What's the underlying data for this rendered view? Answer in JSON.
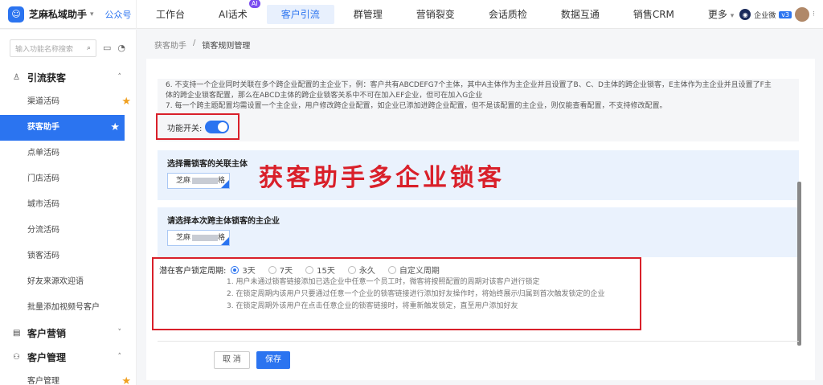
{
  "app": {
    "name": "芝麻私域助手",
    "tag": "公众号",
    "logo_glyph": "☺"
  },
  "nav": [
    {
      "label": "工作台",
      "badge": ""
    },
    {
      "label": "AI话术",
      "badge": "AI"
    },
    {
      "label": "客户引流",
      "badge": ""
    },
    {
      "label": "群管理",
      "badge": ""
    },
    {
      "label": "营销裂变",
      "badge": ""
    },
    {
      "label": "会话质检",
      "badge": ""
    },
    {
      "label": "数据互通",
      "badge": ""
    },
    {
      "label": "销售CRM",
      "badge": ""
    },
    {
      "label": "更多",
      "badge": ""
    }
  ],
  "topright": {
    "corp_label": "企业微",
    "version": "v3",
    "more": "⁝"
  },
  "sidebar": {
    "search_placeholder": "输入功能名称搜索",
    "groups": [
      {
        "label": "引流获客",
        "icon": "user-plus-icon",
        "expanded": true
      },
      {
        "label": "客户营销",
        "icon": "calendar-icon",
        "expanded": false
      },
      {
        "label": "客户管理",
        "icon": "user-manage-icon",
        "expanded": true
      }
    ],
    "items": [
      {
        "label": "渠道活码",
        "starred": true
      },
      {
        "label": "获客助手",
        "starred": true
      },
      {
        "label": "点单活码",
        "starred": false
      },
      {
        "label": "门店活码",
        "starred": false
      },
      {
        "label": "城市活码",
        "starred": false
      },
      {
        "label": "分流活码",
        "starred": false
      },
      {
        "label": "锁客活码",
        "starred": false
      },
      {
        "label": "好友来源欢迎语",
        "starred": false
      },
      {
        "label": "批量添加视频号客户",
        "starred": false
      },
      {
        "label": "客户管理",
        "starred": true
      }
    ]
  },
  "breadcrumb": {
    "parent": "获客助手",
    "sep": "/",
    "current": "锁客规则管理"
  },
  "notes": {
    "line6": "6. 不支持一个企业同时关联在多个跨企业配置的主企业下，例：客户共有ABCDEFG7个主体，其中A主体作为主企业并且设置了B、C、D主体的跨企业锁客，E主体作为主企业并且设置了F主",
    "line6b": "体的跨企业锁客配置，那么在ABCD主体的跨企业锁客关系中不可在加入EF企业，但可在加入G企业",
    "line7": "7. 每一个跨主题配置均需设置一个主企业，用户修改跨企业配置，如企业已添加进跨企业配置，但不是该配置的主企业，则仅能查看配置，不支持修改配置。"
  },
  "toggle": {
    "label": "功能开关:",
    "on": true
  },
  "section1": {
    "title": "选择需锁客的关联主体",
    "tag_prefix": "芝麻",
    "tag_suffix": "格"
  },
  "section2": {
    "title": "请选择本次跨主体锁客的主企业",
    "tag_prefix": "芝麻",
    "tag_suffix": "格"
  },
  "overlay_text": "获客助手多企业锁客",
  "period": {
    "label": "潜在客户锁定周期:",
    "options": [
      "3天",
      "7天",
      "15天",
      "永久",
      "自定义周期"
    ],
    "selected_index": 0,
    "notes": [
      "1. 用户未通过锁客链接添加已选企业中任意一个员工时，微客将按照配置的周期对该客户进行锁定",
      "2. 在锁定周期内该用户只要通过任意一个企业的锁客链接进行添加好友操作时，将始终展示归属到首次触发锁定的企业",
      "3. 在锁定周期外该用户在点击任意企业的锁客链接时，将重新触发锁定，直至用户添加好友"
    ]
  },
  "buttons": {
    "cancel": "取 消",
    "save": "保存"
  },
  "colors": {
    "accent": "#2b74f0",
    "highlight": "#d9202a",
    "star": "#f0a020"
  }
}
